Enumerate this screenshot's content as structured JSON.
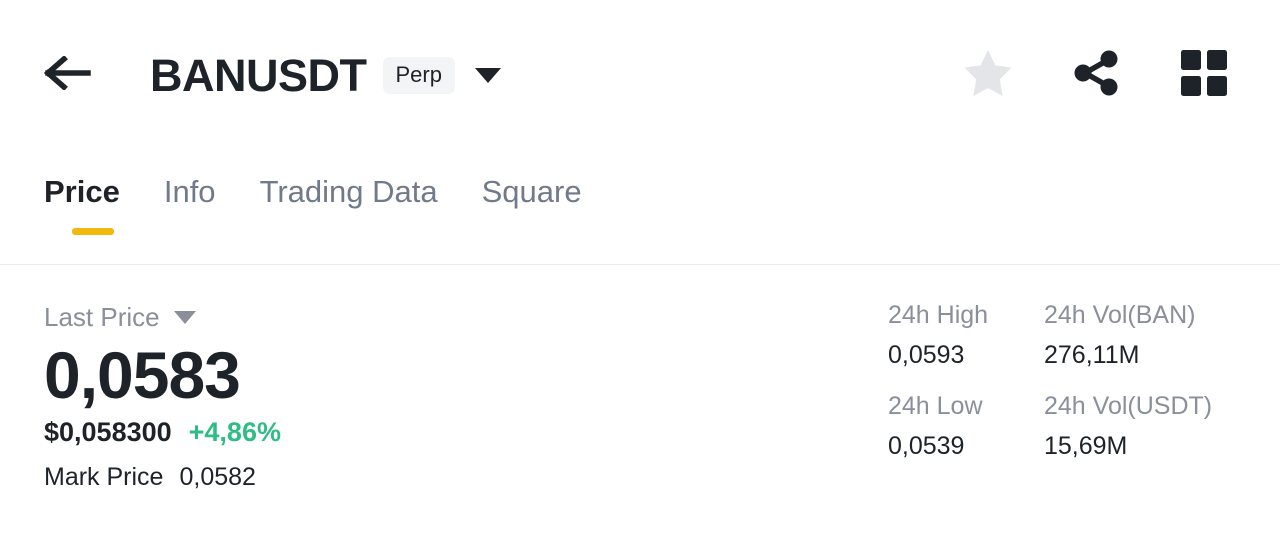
{
  "header": {
    "back_icon": "arrow-left-icon",
    "pair": "BANUSDT",
    "contract_badge": "Perp",
    "dropdown_icon": "chevron-down-icon",
    "favorite_icon": "star-icon",
    "share_icon": "share-icon",
    "grid_icon": "grid-icon"
  },
  "tabs": [
    {
      "label": "Price",
      "active": true
    },
    {
      "label": "Info",
      "active": false
    },
    {
      "label": "Trading Data",
      "active": false
    },
    {
      "label": "Square",
      "active": false
    }
  ],
  "price": {
    "selector_label": "Last Price",
    "selector_icon": "caret-down-icon",
    "value": "0,0583",
    "usd_value": "$0,058300",
    "change_percent": "+4,86%",
    "mark_price_label": "Mark Price",
    "mark_price_value": "0,0582"
  },
  "stats": [
    {
      "label": "24h High",
      "value": "0,0593"
    },
    {
      "label": "24h Vol(BAN)",
      "value": "276,11M"
    },
    {
      "label": "24h Low",
      "value": "0,0539"
    },
    {
      "label": "24h Vol(USDT)",
      "value": "15,69M"
    }
  ],
  "colors": {
    "accent_yellow": "#F0B90B",
    "positive_green": "#2EBD85",
    "text_primary": "#1E2329",
    "text_secondary": "#8A8F9A",
    "divider": "#EAECEF",
    "badge_bg": "#F3F4F6",
    "star_gray": "#E3E5E9"
  }
}
